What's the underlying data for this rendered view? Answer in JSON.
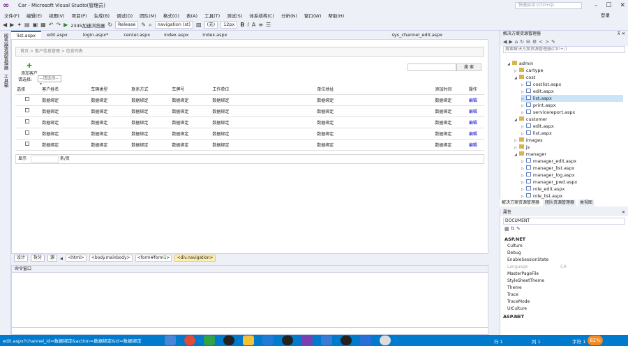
{
  "window": {
    "title": "Car - Microsoft Visual Studio(管理员)",
    "quick_launch_placeholder": "快速启动 (Ctrl+Q)",
    "signin": "登录"
  },
  "menu": [
    "文件(F)",
    "编辑(E)",
    "视图(V)",
    "项目(P)",
    "生成(B)",
    "调试(D)",
    "团队(M)",
    "格式(O)",
    "表(A)",
    "工具(T)",
    "测试(S)",
    "体系结构(C)",
    "分析(N)",
    "窗口(W)",
    "帮助(H)"
  ],
  "toolbar": {
    "run_target": "2345加速浏览器",
    "config": "Release",
    "block_format": "navigation (st)",
    "font": "(无)",
    "size": "12px"
  },
  "left_tabs": [
    "服务器资源管理器",
    "工具箱"
  ],
  "doc_tabs": [
    "list.aspx",
    "edit.aspx",
    "login.aspx*",
    "center.aspx",
    "index.aspx",
    "index.aspx",
    "sys_channel_edit.aspx"
  ],
  "designer": {
    "breadcrumb": "首页 > 客户信息管理 > 信息列表",
    "add_label": "添加客户",
    "search_button": "搜 索",
    "filter_label": "请选择:",
    "filter_value": "--请选择--",
    "columns": [
      "选择",
      "客户姓名",
      "车辆类型",
      "联系方式",
      "车牌号",
      "工作单位",
      "单位地址",
      "添加时间",
      "操作"
    ],
    "rows": [
      [
        "数据绑定",
        "数据绑定",
        "数据绑定",
        "数据绑定",
        "数据绑定",
        "数据绑定",
        "数据绑定",
        "编辑"
      ],
      [
        "数据绑定",
        "数据绑定",
        "数据绑定",
        "数据绑定",
        "数据绑定",
        "数据绑定",
        "数据绑定",
        "编辑"
      ],
      [
        "数据绑定",
        "数据绑定",
        "数据绑定",
        "数据绑定",
        "数据绑定",
        "数据绑定",
        "数据绑定",
        "编辑"
      ],
      [
        "数据绑定",
        "数据绑定",
        "数据绑定",
        "数据绑定",
        "数据绑定",
        "数据绑定",
        "数据绑定",
        "编辑"
      ],
      [
        "数据绑定",
        "数据绑定",
        "数据绑定",
        "数据绑定",
        "数据绑定",
        "数据绑定",
        "数据绑定",
        "编辑"
      ]
    ],
    "pager_left": "显示",
    "pager_right": "条/页"
  },
  "design_bar": {
    "design": "设计",
    "split": "拆分",
    "source": "源",
    "crumbs": [
      "<html>",
      "<body.mainbody>",
      "<form#form1>",
      "<div.navigation>"
    ]
  },
  "command_window": {
    "title": "命令窗口"
  },
  "solution_explorer": {
    "title": "解决方案资源管理器",
    "search_placeholder": "搜索解决方案资源管理器(Ctrl+;)",
    "tree": [
      {
        "label": "admin",
        "type": "folder",
        "level": 0,
        "expanded": true
      },
      {
        "label": "cartype",
        "type": "folder",
        "level": 1
      },
      {
        "label": "cost",
        "type": "folder",
        "level": 1,
        "expanded": true
      },
      {
        "label": "costlist.aspx",
        "type": "page",
        "level": 2
      },
      {
        "label": "edit.aspx",
        "type": "page",
        "level": 2
      },
      {
        "label": "list.aspx",
        "type": "page",
        "level": 2,
        "selected": true
      },
      {
        "label": "print.aspx",
        "type": "page",
        "level": 2
      },
      {
        "label": "servicereport.aspx",
        "type": "page",
        "level": 2
      },
      {
        "label": "customer",
        "type": "folder",
        "level": 1,
        "expanded": true
      },
      {
        "label": "edit.aspx",
        "type": "page",
        "level": 2
      },
      {
        "label": "list.aspx",
        "type": "page",
        "level": 2
      },
      {
        "label": "images",
        "type": "folder",
        "level": 1
      },
      {
        "label": "js",
        "type": "folder",
        "level": 1
      },
      {
        "label": "manager",
        "type": "folder",
        "level": 1,
        "expanded": true
      },
      {
        "label": "manager_edit.aspx",
        "type": "page",
        "level": 2
      },
      {
        "label": "manager_list.aspx",
        "type": "page",
        "level": 2
      },
      {
        "label": "manager_log.aspx",
        "type": "page",
        "level": 2
      },
      {
        "label": "manager_pwd.aspx",
        "type": "page",
        "level": 2
      },
      {
        "label": "role_edit.aspx",
        "type": "page",
        "level": 2
      },
      {
        "label": "role_list.aspx",
        "type": "page",
        "level": 2
      }
    ],
    "tabs": [
      "解决方案资源管理器",
      "团队资源管理器",
      "类视图"
    ]
  },
  "properties": {
    "title": "属性",
    "object": "DOCUMENT",
    "category": "ASP.NET",
    "items": [
      {
        "name": "Culture",
        "value": ""
      },
      {
        "name": "Debug",
        "value": ""
      },
      {
        "name": "EnableSessionState",
        "value": ""
      },
      {
        "name": "Language",
        "value": "C#",
        "gray": true
      },
      {
        "name": "MasterPageFile",
        "value": ""
      },
      {
        "name": "StyleSheetTheme",
        "value": ""
      },
      {
        "name": "Theme",
        "value": ""
      },
      {
        "name": "Trace",
        "value": ""
      },
      {
        "name": "TraceMode",
        "value": ""
      },
      {
        "name": "UICulture",
        "value": ""
      }
    ],
    "description": "ASP.NET"
  },
  "status": {
    "text": "edit.aspx?channel_id=数据绑定&action=数据绑定&id=数据绑定",
    "ln": "行 1",
    "col": "列 1",
    "ch": "字符 1",
    "pct": "82%"
  }
}
